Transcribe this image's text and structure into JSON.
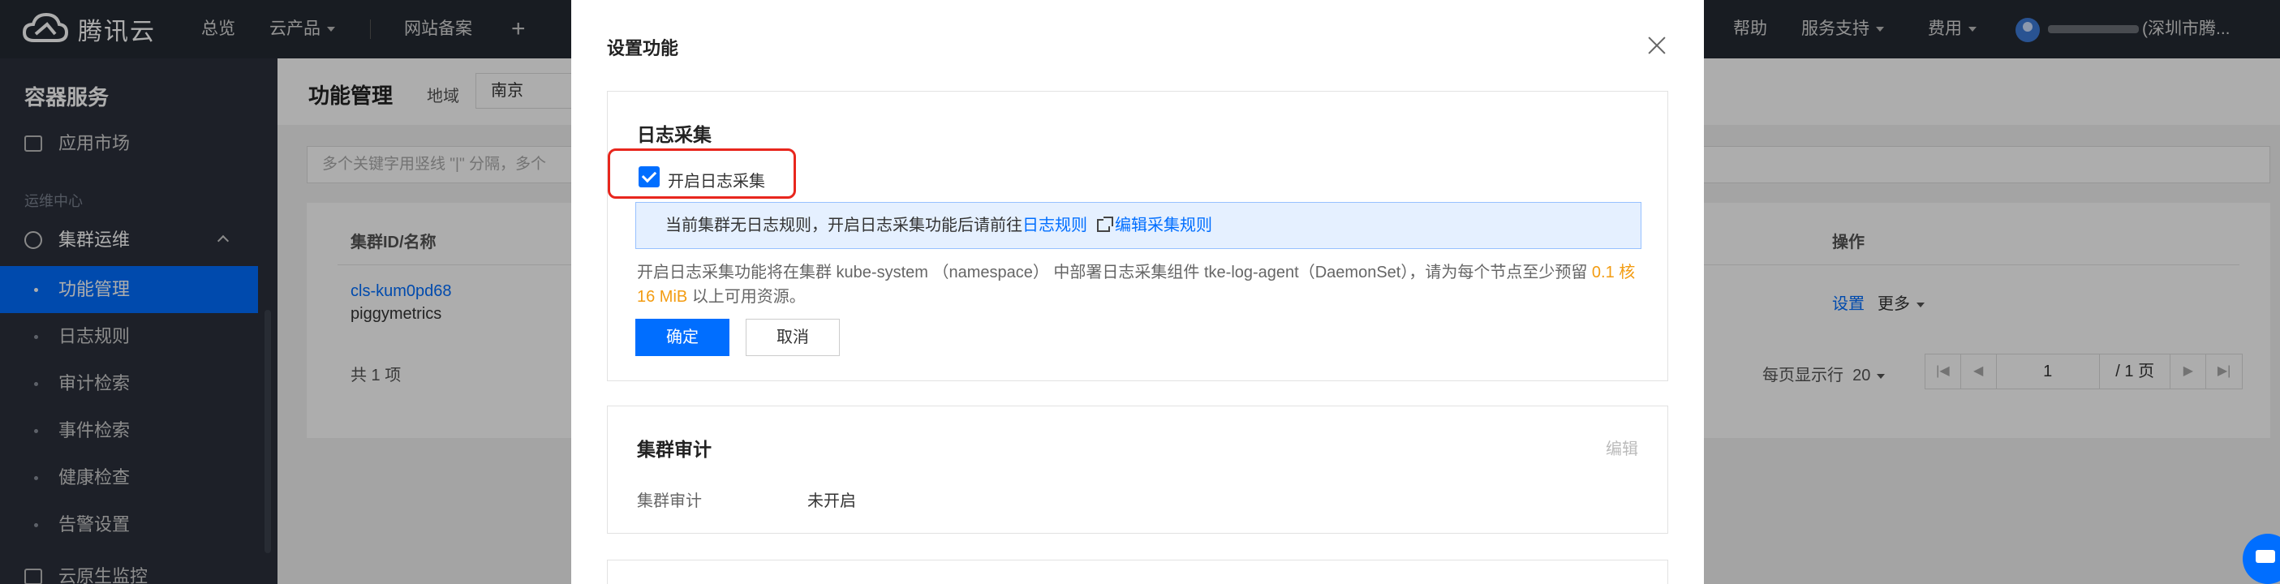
{
  "topnav": {
    "brand": "腾讯云",
    "items": {
      "overview": "总览",
      "products": "云产品",
      "beian": "网站备案",
      "help": "帮助",
      "support": "服务支持",
      "billing": "费用",
      "account": "(深圳市腾..."
    }
  },
  "sidebar": {
    "title": "容器服务",
    "app_market": "应用市场",
    "section": "运维中心",
    "group": "集群运维",
    "subitems": [
      "功能管理",
      "日志规则",
      "审计检索",
      "事件检索",
      "健康检查",
      "告警设置"
    ],
    "bottom_item": "云原生监控"
  },
  "page": {
    "title": "功能管理",
    "region_label": "地域",
    "region_value": "南京",
    "search_placeholder": "多个关键字用竖线 \"|\" 分隔，多个",
    "table": {
      "col_id": "集群ID/名称",
      "col_ops": "操作",
      "row": {
        "id": "cls-kum0pd68",
        "name": "piggymetrics",
        "set": "设置",
        "more": "更多"
      },
      "total": "共 1 项",
      "per_page_label": "每页显示行",
      "per_page_value": "20",
      "page_input": "1",
      "page_total": "/ 1 页"
    }
  },
  "modal": {
    "title": "设置功能",
    "log": {
      "header": "日志采集",
      "checkbox_label": "开启日志采集",
      "checked": true,
      "info_text": "当前集群无日志规则，开启日志采集功能后请前往",
      "info_link1": "日志规则",
      "info_link2": "编辑采集规则",
      "desc_pre": "开启日志采集功能将在集群 kube-system （namespace） 中部署日志采集组件 tke-log-agent（DaemonSet），请为每个节点至少预留",
      "desc_resource": "0.1 核 16 MiB",
      "desc_post": "以上可用资源。",
      "ok": "确定",
      "cancel": "取消"
    },
    "audit": {
      "header": "集群审计",
      "edit": "编辑",
      "key": "集群审计",
      "value": "未开启"
    }
  },
  "colors": {
    "brand": "#006eff",
    "nav_bg": "#242a33",
    "sidebar_bg": "#2b303b",
    "highlight": "#e8261d",
    "resource": "#f39c12"
  }
}
